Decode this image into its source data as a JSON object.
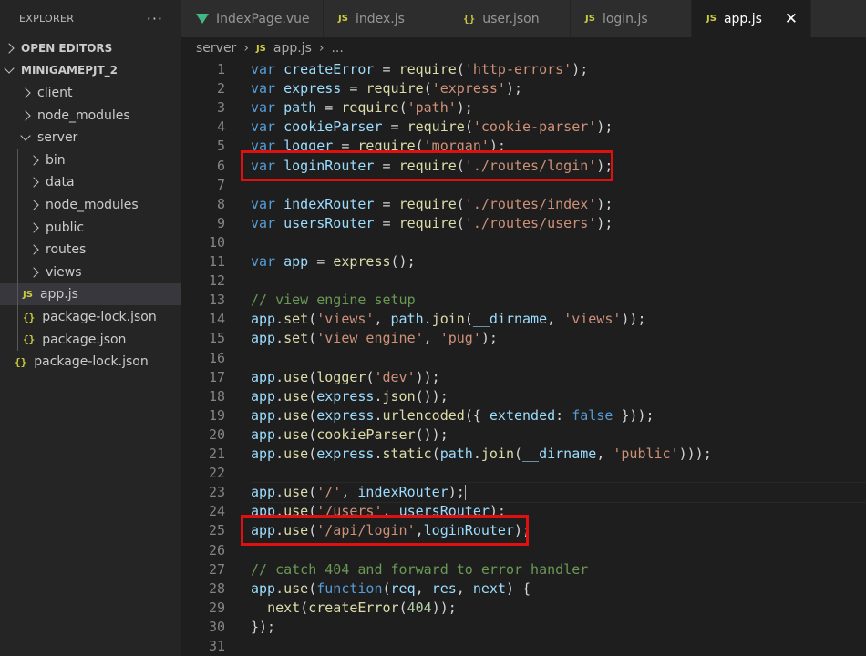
{
  "explorer": {
    "title": "EXPLORER",
    "more_icon": "ellipsis-icon",
    "open_editors": "OPEN EDITORS",
    "project": "MINIGAMEPJT_2",
    "tree": [
      {
        "label": "client",
        "type": "folder",
        "depth": 1,
        "expanded": false
      },
      {
        "label": "node_modules",
        "type": "folder",
        "depth": 1,
        "expanded": false
      },
      {
        "label": "server",
        "type": "folder",
        "depth": 1,
        "expanded": true
      },
      {
        "label": "bin",
        "type": "folder",
        "depth": 2,
        "expanded": false
      },
      {
        "label": "data",
        "type": "folder",
        "depth": 2,
        "expanded": false
      },
      {
        "label": "node_modules",
        "type": "folder",
        "depth": 2,
        "expanded": false
      },
      {
        "label": "public",
        "type": "folder",
        "depth": 2,
        "expanded": false
      },
      {
        "label": "routes",
        "type": "folder",
        "depth": 2,
        "expanded": false
      },
      {
        "label": "views",
        "type": "folder",
        "depth": 2,
        "expanded": false
      },
      {
        "label": "app.js",
        "type": "js",
        "depth": 2,
        "selected": true
      },
      {
        "label": "package-lock.json",
        "type": "json",
        "depth": 2
      },
      {
        "label": "package.json",
        "type": "json",
        "depth": 2
      },
      {
        "label": "package-lock.json",
        "type": "json",
        "depth": 1
      }
    ]
  },
  "tabs": [
    {
      "label": "IndexPage.vue",
      "icon": "vue-icon"
    },
    {
      "label": "index.js",
      "icon": "JS"
    },
    {
      "label": "user.json",
      "icon": "{}"
    },
    {
      "label": "login.js",
      "icon": "JS"
    },
    {
      "label": "app.js",
      "icon": "JS",
      "active": true
    }
  ],
  "close_icon": "close-icon",
  "breadcrumb": {
    "folder": "server",
    "file": "app.js",
    "rest": "..."
  },
  "code": [
    [
      [
        "k",
        "var"
      ],
      [
        "o",
        " "
      ],
      [
        "v",
        "createError"
      ],
      [
        "o",
        " = "
      ],
      [
        "f",
        "require"
      ],
      [
        "o",
        "("
      ],
      [
        "s",
        "'http-errors'"
      ],
      [
        "o",
        ");"
      ]
    ],
    [
      [
        "k",
        "var"
      ],
      [
        "o",
        " "
      ],
      [
        "v",
        "express"
      ],
      [
        "o",
        " = "
      ],
      [
        "f",
        "require"
      ],
      [
        "o",
        "("
      ],
      [
        "s",
        "'express'"
      ],
      [
        "o",
        ");"
      ]
    ],
    [
      [
        "k",
        "var"
      ],
      [
        "o",
        " "
      ],
      [
        "v",
        "path"
      ],
      [
        "o",
        " = "
      ],
      [
        "f",
        "require"
      ],
      [
        "o",
        "("
      ],
      [
        "s",
        "'path'"
      ],
      [
        "o",
        ");"
      ]
    ],
    [
      [
        "k",
        "var"
      ],
      [
        "o",
        " "
      ],
      [
        "v",
        "cookieParser"
      ],
      [
        "o",
        " = "
      ],
      [
        "f",
        "require"
      ],
      [
        "o",
        "("
      ],
      [
        "s",
        "'cookie-parser'"
      ],
      [
        "o",
        ");"
      ]
    ],
    [
      [
        "k",
        "var"
      ],
      [
        "o",
        " "
      ],
      [
        "v",
        "logger"
      ],
      [
        "o",
        " = "
      ],
      [
        "f",
        "require"
      ],
      [
        "o",
        "("
      ],
      [
        "s",
        "'morgan'"
      ],
      [
        "o",
        ");"
      ]
    ],
    [
      [
        "k",
        "var"
      ],
      [
        "o",
        " "
      ],
      [
        "v",
        "loginRouter"
      ],
      [
        "o",
        " = "
      ],
      [
        "f",
        "require"
      ],
      [
        "o",
        "("
      ],
      [
        "s",
        "'./routes/login'"
      ],
      [
        "o",
        ");"
      ]
    ],
    [],
    [
      [
        "k",
        "var"
      ],
      [
        "o",
        " "
      ],
      [
        "v",
        "indexRouter"
      ],
      [
        "o",
        " = "
      ],
      [
        "f",
        "require"
      ],
      [
        "o",
        "("
      ],
      [
        "s",
        "'./routes/index'"
      ],
      [
        "o",
        ");"
      ]
    ],
    [
      [
        "k",
        "var"
      ],
      [
        "o",
        " "
      ],
      [
        "v",
        "usersRouter"
      ],
      [
        "o",
        " = "
      ],
      [
        "f",
        "require"
      ],
      [
        "o",
        "("
      ],
      [
        "s",
        "'./routes/users'"
      ],
      [
        "o",
        ");"
      ]
    ],
    [],
    [
      [
        "k",
        "var"
      ],
      [
        "o",
        " "
      ],
      [
        "v",
        "app"
      ],
      [
        "o",
        " = "
      ],
      [
        "f",
        "express"
      ],
      [
        "o",
        "();"
      ]
    ],
    [],
    [
      [
        "c",
        "// view engine setup"
      ]
    ],
    [
      [
        "v",
        "app"
      ],
      [
        "o",
        "."
      ],
      [
        "f",
        "set"
      ],
      [
        "o",
        "("
      ],
      [
        "s",
        "'views'"
      ],
      [
        "o",
        ", "
      ],
      [
        "v",
        "path"
      ],
      [
        "o",
        "."
      ],
      [
        "f",
        "join"
      ],
      [
        "o",
        "("
      ],
      [
        "v",
        "__dirname"
      ],
      [
        "o",
        ", "
      ],
      [
        "s",
        "'views'"
      ],
      [
        "o",
        "));"
      ]
    ],
    [
      [
        "v",
        "app"
      ],
      [
        "o",
        "."
      ],
      [
        "f",
        "set"
      ],
      [
        "o",
        "("
      ],
      [
        "s",
        "'view engine'"
      ],
      [
        "o",
        ", "
      ],
      [
        "s",
        "'pug'"
      ],
      [
        "o",
        ");"
      ]
    ],
    [],
    [
      [
        "v",
        "app"
      ],
      [
        "o",
        "."
      ],
      [
        "f",
        "use"
      ],
      [
        "o",
        "("
      ],
      [
        "f",
        "logger"
      ],
      [
        "o",
        "("
      ],
      [
        "s",
        "'dev'"
      ],
      [
        "o",
        "));"
      ]
    ],
    [
      [
        "v",
        "app"
      ],
      [
        "o",
        "."
      ],
      [
        "f",
        "use"
      ],
      [
        "o",
        "("
      ],
      [
        "v",
        "express"
      ],
      [
        "o",
        "."
      ],
      [
        "f",
        "json"
      ],
      [
        "o",
        "());"
      ]
    ],
    [
      [
        "v",
        "app"
      ],
      [
        "o",
        "."
      ],
      [
        "f",
        "use"
      ],
      [
        "o",
        "("
      ],
      [
        "v",
        "express"
      ],
      [
        "o",
        "."
      ],
      [
        "f",
        "urlencoded"
      ],
      [
        "o",
        "({ "
      ],
      [
        "v",
        "extended"
      ],
      [
        "o",
        ": "
      ],
      [
        "k",
        "false"
      ],
      [
        "o",
        " }));"
      ]
    ],
    [
      [
        "v",
        "app"
      ],
      [
        "o",
        "."
      ],
      [
        "f",
        "use"
      ],
      [
        "o",
        "("
      ],
      [
        "f",
        "cookieParser"
      ],
      [
        "o",
        "());"
      ]
    ],
    [
      [
        "v",
        "app"
      ],
      [
        "o",
        "."
      ],
      [
        "f",
        "use"
      ],
      [
        "o",
        "("
      ],
      [
        "v",
        "express"
      ],
      [
        "o",
        "."
      ],
      [
        "f",
        "static"
      ],
      [
        "o",
        "("
      ],
      [
        "v",
        "path"
      ],
      [
        "o",
        "."
      ],
      [
        "f",
        "join"
      ],
      [
        "o",
        "("
      ],
      [
        "v",
        "__dirname"
      ],
      [
        "o",
        ", "
      ],
      [
        "s",
        "'public'"
      ],
      [
        "o",
        ")));"
      ]
    ],
    [],
    [
      [
        "v",
        "app"
      ],
      [
        "o",
        "."
      ],
      [
        "f",
        "use"
      ],
      [
        "o",
        "("
      ],
      [
        "s",
        "'/'"
      ],
      [
        "o",
        ", "
      ],
      [
        "v",
        "indexRouter"
      ],
      [
        "o",
        ");"
      ]
    ],
    [
      [
        "v",
        "app"
      ],
      [
        "o",
        "."
      ],
      [
        "f",
        "use"
      ],
      [
        "o",
        "("
      ],
      [
        "s",
        "'/users'"
      ],
      [
        "o",
        ", "
      ],
      [
        "v",
        "usersRouter"
      ],
      [
        "o",
        ");"
      ]
    ],
    [
      [
        "v",
        "app"
      ],
      [
        "o",
        "."
      ],
      [
        "f",
        "use"
      ],
      [
        "o",
        "("
      ],
      [
        "s",
        "'/api/login'"
      ],
      [
        "o",
        ","
      ],
      [
        "v",
        "loginRouter"
      ],
      [
        "o",
        ");"
      ]
    ],
    [],
    [
      [
        "c",
        "// catch 404 and forward to error handler"
      ]
    ],
    [
      [
        "v",
        "app"
      ],
      [
        "o",
        "."
      ],
      [
        "f",
        "use"
      ],
      [
        "o",
        "("
      ],
      [
        "k",
        "function"
      ],
      [
        "o",
        "("
      ],
      [
        "v",
        "req"
      ],
      [
        "o",
        ", "
      ],
      [
        "v",
        "res"
      ],
      [
        "o",
        ", "
      ],
      [
        "v",
        "next"
      ],
      [
        "o",
        ") {"
      ]
    ],
    [
      [
        "o",
        "  "
      ],
      [
        "f",
        "next"
      ],
      [
        "o",
        "("
      ],
      [
        "f",
        "createError"
      ],
      [
        "o",
        "("
      ],
      [
        "n",
        "404"
      ],
      [
        "o",
        "));"
      ]
    ],
    [
      [
        "o",
        "});"
      ]
    ],
    []
  ],
  "highlighted_lines": [
    6,
    25
  ],
  "cursor_line": 23,
  "colors": {
    "highlight_box": "#e01010",
    "keyword": "#569cd6",
    "string": "#ce9178",
    "function": "#dcdcaa",
    "variable": "#9cdcfe",
    "comment": "#6a9955"
  }
}
